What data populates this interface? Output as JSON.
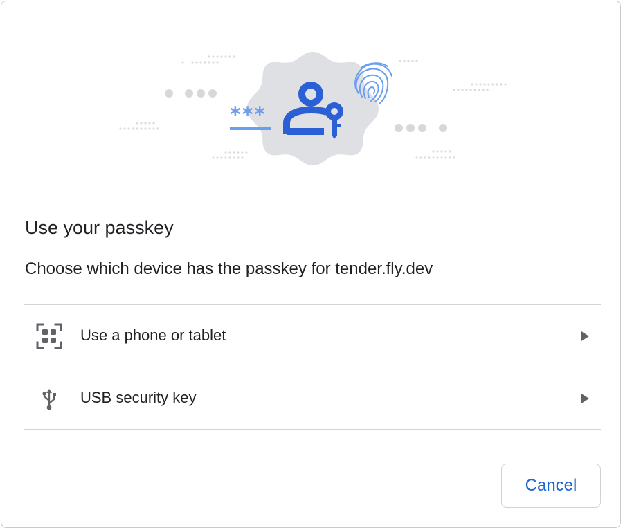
{
  "dialog": {
    "title": "Use your passkey",
    "subtitle": "Choose which device has the passkey for tender.fly.dev",
    "options": [
      {
        "label": "Use a phone or tablet",
        "icon": "qr-code-icon"
      },
      {
        "label": "USB security key",
        "icon": "usb-icon"
      }
    ],
    "cancel_label": "Cancel"
  },
  "illustration": {
    "password_mask": "***",
    "icons": [
      "passkey-user-icon",
      "key-icon",
      "fingerprint-icon"
    ]
  },
  "colors": {
    "accent": "#1a66d2",
    "illustration_blue": "#2a5fd6",
    "light_blue": "#6a9ef0",
    "badge_gray": "#dfe0e3",
    "dot_gray": "#d7d8db",
    "text": "#202124",
    "divider": "#d4d4d4"
  }
}
